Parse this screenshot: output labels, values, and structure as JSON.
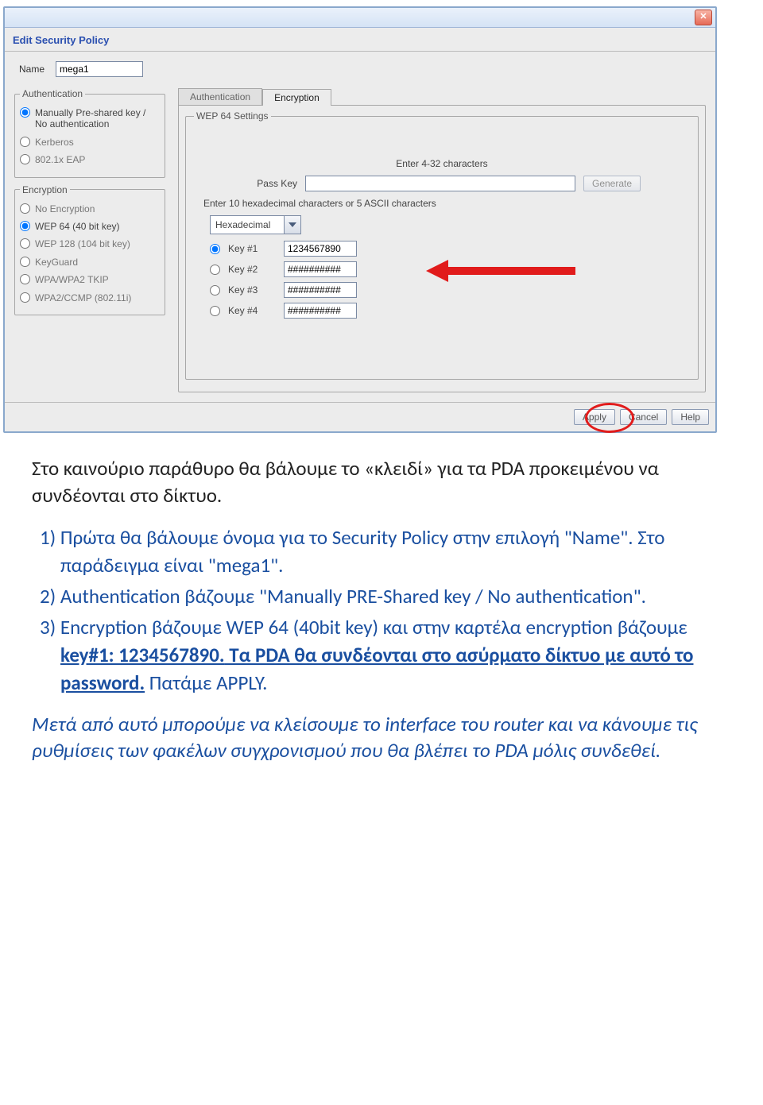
{
  "window": {
    "close_icon": "✕",
    "title": "Edit Security Policy",
    "name_label": "Name",
    "name_value": "mega1"
  },
  "auth": {
    "legend": "Authentication",
    "opt1": "Manually Pre-shared key / No authentication",
    "opt2": "Kerberos",
    "opt3": "802.1x EAP"
  },
  "enc": {
    "legend": "Encryption",
    "opt1": "No Encryption",
    "opt2": "WEP 64 (40 bit key)",
    "opt3": "WEP 128 (104 bit key)",
    "opt4": "KeyGuard",
    "opt5": "WPA/WPA2 TKIP",
    "opt6": "WPA2/CCMP (802.11i)"
  },
  "tabs": {
    "t1": "Authentication",
    "t2": "Encryption"
  },
  "wep": {
    "legend": "WEP 64 Settings",
    "enter_chars": "Enter 4-32 characters",
    "passkey_label": "Pass Key",
    "passkey_value": "",
    "generate": "Generate",
    "hex_note": "Enter 10 hexadecimal characters or 5 ASCII characters",
    "format_value": "Hexadecimal",
    "k1": "Key #1",
    "k2": "Key #2",
    "k3": "Key #3",
    "k4": "Key #4",
    "v1": "1234567890",
    "v2": "##########",
    "v3": "##########",
    "v4": "##########"
  },
  "footer": {
    "apply": "Apply",
    "cancel": "Cancel",
    "help": "Help"
  },
  "doc": {
    "p1": "Στο καινούριο παράθυρο θα βάλουμε το «κλειδί» για τα PDA προκειμένου να συνδέονται στο δίκτυο.",
    "l1": "1) Πρώτα θα βάλουμε όνομα για το Security Policy στην επιλογή \"Name\". Στο παράδειγμα είναι \"mega1\".",
    "l2": "2) Authentication βάζουμε \"Manually PRE-Shared key / No authentication\".",
    "l3a": "3) Encryption βάζουμε WEP 64 (40bit key) και στην καρτέλα encryption βάζουμε ",
    "l3b": "key#1: 1234567890.",
    "l3c": " Τα PDA θα συνδέονται στο ασύρματο δίκτυο με αυτό το password.",
    "l3d": " Πατάμε APPLY.",
    "p2": "Μετά από αυτό μπορούμε να κλείσουμε το interface του router και να κάνουμε τις ρυθμίσεις των φακέλων συγχρονισμού που θα βλέπει το PDA μόλις συνδεθεί."
  }
}
